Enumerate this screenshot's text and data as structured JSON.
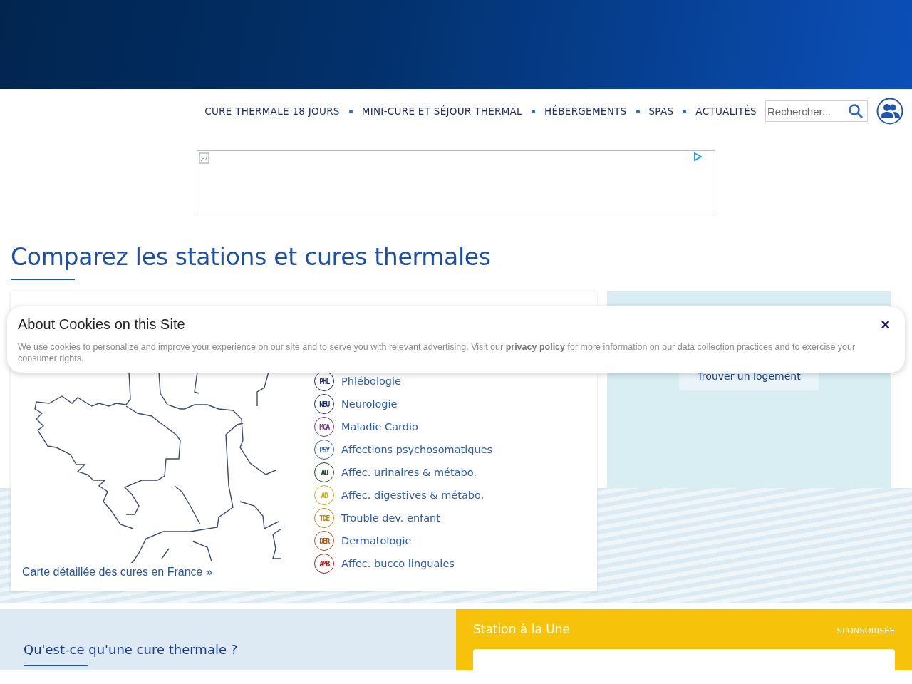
{
  "nav": {
    "items": [
      {
        "label": "CURE THERMALE 18 JOURS"
      },
      {
        "label": "MINI-CURE ET SÉJOUR THERMAL"
      },
      {
        "label": "HÉBERGEMENTS"
      },
      {
        "label": "SPAS"
      },
      {
        "label": "ACTUALITÉS"
      }
    ],
    "search": {
      "placeholder": "Rechercher..."
    }
  },
  "page_title": "Comparez les stations et cures thermales",
  "map_card": {
    "link": "Carte détaillée des cures en France »",
    "specialties": [
      {
        "code": "PHL",
        "label": "Phlébologie",
        "color": "#1d2a5a"
      },
      {
        "code": "NEU",
        "label": "Neurologie",
        "color": "#1b2f7a"
      },
      {
        "code": "MCA",
        "label": "Maladie Cardio",
        "color": "#7a3a78"
      },
      {
        "code": "PSY",
        "label": "Affections psychosomatiques",
        "color": "#3560b0"
      },
      {
        "code": "AU",
        "label": "Affec. urinaires & métabo.",
        "color": "#1f4a2a"
      },
      {
        "code": "AD",
        "label": "Affec. digestives & métabo.",
        "color": "#c9b521"
      },
      {
        "code": "TDE",
        "label": "Trouble dev. enfant",
        "color": "#b58a1a"
      },
      {
        "code": "DER",
        "label": "Dermatologie",
        "color": "#b0561a"
      },
      {
        "code": "AMB",
        "label": "Affec. bucco linguales",
        "color": "#a3201e"
      }
    ]
  },
  "lodging": {
    "button": "Trouver un logement"
  },
  "cookie_banner": {
    "title": "About Cookies on this Site",
    "text_before": "We use cookies to personalize and improve your experience on our site and to serve you with relevant advertising. Visit our",
    "link": "privacy policy",
    "text_after": "for more information on our data collection practices and to exercise your consumer rights.",
    "close": "×"
  },
  "bottom": {
    "question": "Qu'est-ce qu'une cure thermale ?",
    "featured_title": "Station à la Une",
    "sponsored": "SPONSORISÉE"
  }
}
